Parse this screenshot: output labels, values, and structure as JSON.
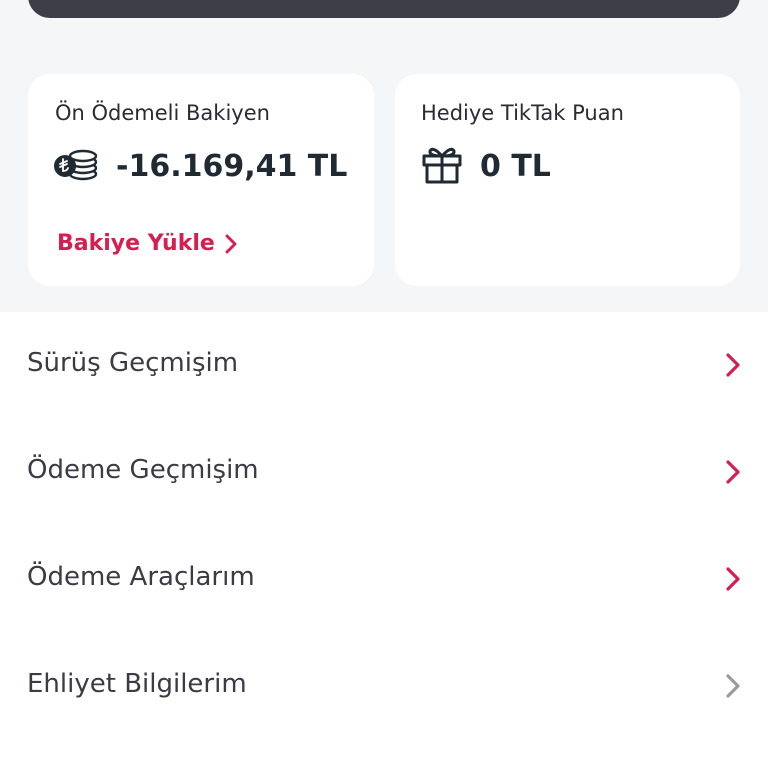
{
  "balance_card": {
    "title": "Ön Ödemeli Bakiyen",
    "amount": "-16.169,41 TL",
    "icon": "coins-icon",
    "topup_label": "Bakiye Yükle"
  },
  "gift_card": {
    "title": "Hediye TikTak Puan",
    "amount": "0 TL",
    "icon": "gift-icon"
  },
  "menu": {
    "items": [
      {
        "label": "Sürüş Geçmişim",
        "chevron_color": "#d61f4f"
      },
      {
        "label": "Ödeme Geçmişim",
        "chevron_color": "#d61f4f"
      },
      {
        "label": "Ödeme Araçlarım",
        "chevron_color": "#d61f4f"
      },
      {
        "label": "Ehliyet Bilgilerim",
        "chevron_color": "#9a9ba1"
      }
    ]
  },
  "colors": {
    "accent": "#d61f4f",
    "banner": "#3d3e47",
    "background": "#f5f6f8"
  }
}
